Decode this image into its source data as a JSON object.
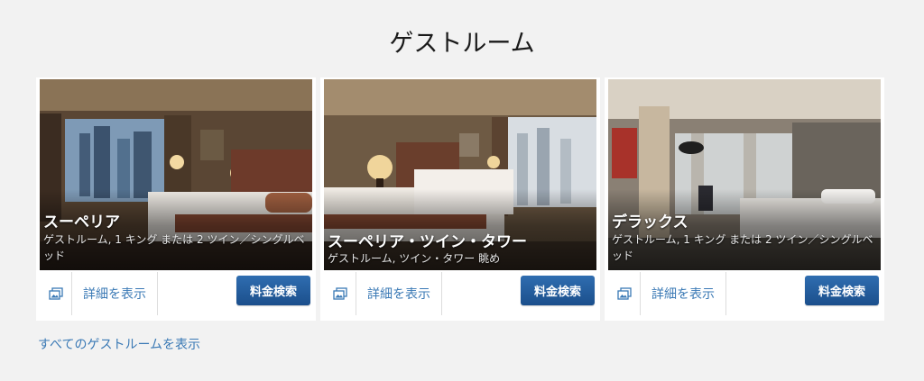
{
  "section": {
    "title": "ゲストルーム"
  },
  "rooms": [
    {
      "name": "スーペリア",
      "description": "ゲストルーム, 1 キング または 2 ツイン／シングルベッド",
      "details_label": "詳細を表示",
      "rate_label": "料金検索"
    },
    {
      "name": "スーペリア・ツイン・タワー",
      "description": "ゲストルーム, ツイン・タワー 眺め",
      "details_label": "詳細を表示",
      "rate_label": "料金検索"
    },
    {
      "name": "デラックス",
      "description": "ゲストルーム, 1 キング または 2 ツイン／シングルベッド",
      "details_label": "詳細を表示",
      "rate_label": "料金検索"
    }
  ],
  "footer": {
    "view_all_label": "すべてのゲストルームを表示"
  },
  "colors": {
    "link": "#3a79b5",
    "button": "#24599a",
    "background": "#f2f2f2"
  },
  "icons": {
    "gallery": "photo-gallery-icon"
  }
}
